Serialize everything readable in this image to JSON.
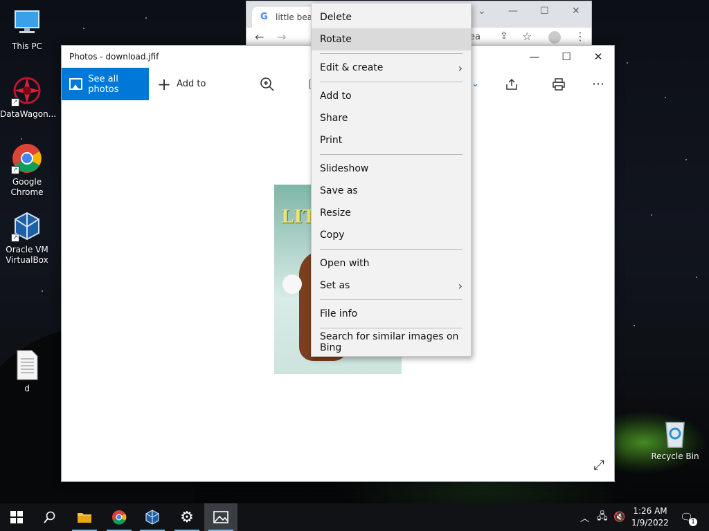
{
  "desktop": {
    "icons": [
      {
        "label": "This PC"
      },
      {
        "label": "DataWagon..."
      },
      {
        "label": "Google Chrome"
      },
      {
        "label": "Oracle VM VirtualBox"
      },
      {
        "label": "d"
      },
      {
        "label": "Recycle Bin"
      }
    ]
  },
  "chrome": {
    "tab_title": "little bear",
    "tab_favicon": "G",
    "peek_text": "ea"
  },
  "photos": {
    "title": "Photos - download.jfif",
    "toolbar": {
      "see_all": "See all photos",
      "add_to": "Add to"
    },
    "image_title_fragment": "LIT"
  },
  "context_menu": {
    "groups": [
      [
        {
          "label": "Delete"
        },
        {
          "label": "Rotate",
          "hover": true
        }
      ],
      [
        {
          "label": "Edit & create",
          "submenu": true
        }
      ],
      [
        {
          "label": "Add to"
        },
        {
          "label": "Share"
        },
        {
          "label": "Print"
        }
      ],
      [
        {
          "label": "Slideshow"
        },
        {
          "label": "Save as"
        },
        {
          "label": "Resize"
        },
        {
          "label": "Copy"
        }
      ],
      [
        {
          "label": "Open with"
        },
        {
          "label": "Set as",
          "submenu": true
        }
      ],
      [
        {
          "label": "File info"
        }
      ],
      [
        {
          "label": "Search for similar images on Bing"
        }
      ]
    ]
  },
  "taskbar": {
    "time": "1:26 AM",
    "date": "1/9/2022",
    "notification_count": "1"
  },
  "colors": {
    "accent": "#0078d7",
    "menu_bg": "#f2f2f2",
    "menu_hover": "#dadada",
    "taskbar": "#101216"
  }
}
